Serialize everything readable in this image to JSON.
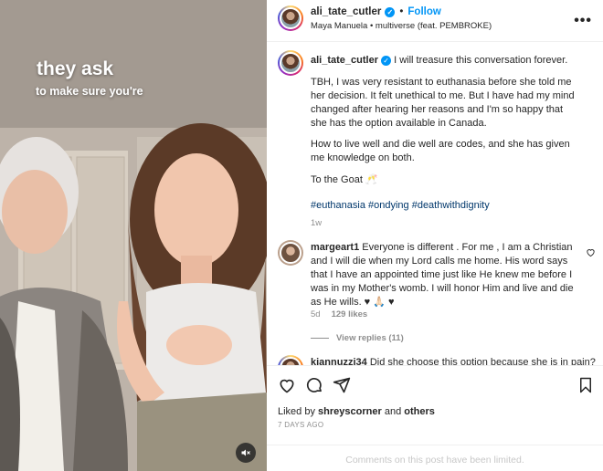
{
  "media": {
    "overlay_title": "they ask",
    "overlay_subtitle": "to make sure you're",
    "mute_icon": "speaker-muted-icon"
  },
  "header": {
    "username": "ali_tate_cutler",
    "follow_label": "Follow",
    "audio": "Maya Manuela • multiverse (feat. PEMBROKE)",
    "more_icon": "more-horizontal-icon"
  },
  "caption": {
    "username": "ali_tate_cutler",
    "intro": "I will treasure this conversation forever.",
    "paragraph1": "TBH, I was very resistant to euthanasia before she told me her decision. It felt unethical to me. But I have had my mind changed after hearing her reasons and I'm so happy that she has the option available in Canada.",
    "paragraph2": "How to live well and die well are codes, and she has given me knowledge on both.",
    "paragraph3": "To the Goat 🥂",
    "hashtags": "#euthanasia #ondying #deathwithdignity",
    "age": "1w"
  },
  "comment": {
    "username": "margeart1",
    "text": "Everyone is different . For me , I am a Christian and I will die when my Lord calls me home. His word says that I have an appointed time just like He knew me before I was in my Mother's womb. I will honor Him and live and die as He wills. ♥ 🙏🏻 ♥",
    "age": "5d",
    "likes": "129 likes",
    "view_replies": "View replies (11)"
  },
  "next_comment": {
    "username": "kiannuzzi34",
    "text": "Did she choose this option because she is in pain?"
  },
  "actions": {
    "liked_by_prefix": "Liked by",
    "liked_by_user": "shreyscorner",
    "liked_by_and": "and",
    "liked_by_others": "others",
    "date": "7 DAYS AGO",
    "comments_limited": "Comments on this post have been limited."
  },
  "colors": {
    "link_blue": "#0095f6",
    "hashtag_blue": "#00376b",
    "muted_text": "#8e8e8e"
  }
}
